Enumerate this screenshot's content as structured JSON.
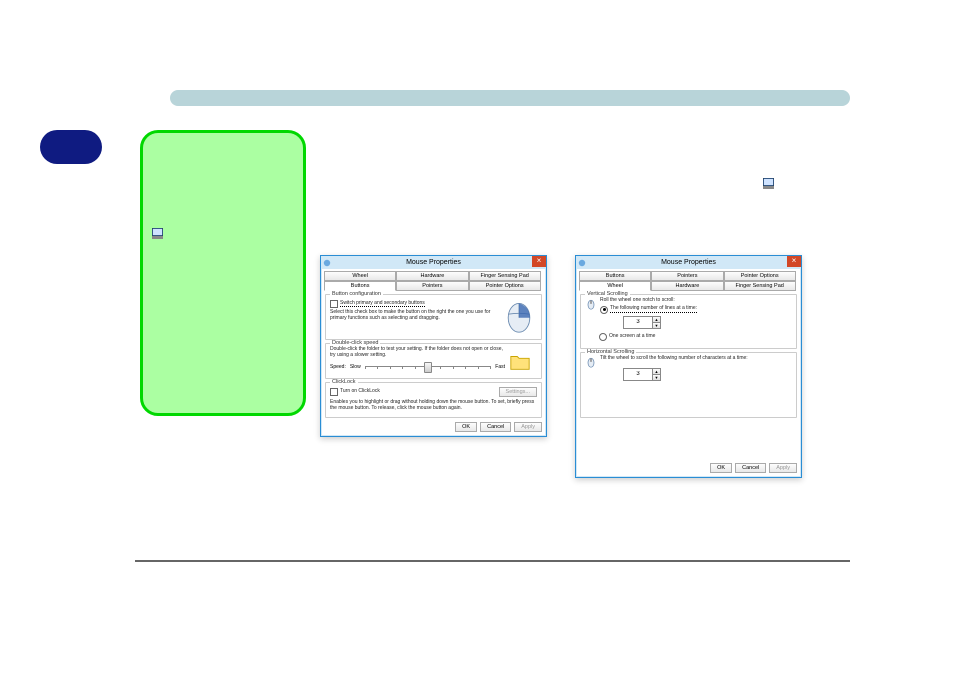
{
  "colors": {
    "accent": "#2a8dd4",
    "pill": "#0f1b81",
    "green": "#00d800"
  },
  "dialogs": [
    {
      "title": "Mouse Properties",
      "close": "×",
      "tabs_row1": [
        "Wheel",
        "Hardware",
        "Finger Sensing Pad"
      ],
      "tabs_row2": [
        "Buttons",
        "Pointers",
        "Pointer Options"
      ],
      "active_tab": "Buttons",
      "group1": {
        "title": "Button configuration",
        "cb_label": "Switch primary and secondary buttons",
        "desc": "Select this check box to make the button on the right the one you use for primary functions such as selecting and dragging."
      },
      "group2": {
        "title": "Double-click speed",
        "desc": "Double-click the folder to test your setting. If the folder does not open or close, try using a slower setting.",
        "speed_label": "Speed:",
        "slow": "Slow",
        "fast": "Fast"
      },
      "group3": {
        "title": "ClickLock",
        "cb_label": "Turn on ClickLock",
        "settings_btn": "Settings...",
        "desc": "Enables you to highlight or drag without holding down the mouse button. To set, briefly press the mouse button. To release, click the mouse button again."
      },
      "footer": {
        "ok": "OK",
        "cancel": "Cancel",
        "apply": "Apply"
      }
    },
    {
      "title": "Mouse Properties",
      "close": "×",
      "tabs_row1": [
        "Buttons",
        "Pointers",
        "Pointer Options"
      ],
      "tabs_row2": [
        "Wheel",
        "Hardware",
        "Finger Sensing Pad"
      ],
      "active_tab": "Wheel",
      "group1": {
        "title": "Vertical Scrolling",
        "line1": "Roll the wheel one notch to scroll:",
        "opt1": "The following number of lines at a time:",
        "opt1_value": "3",
        "opt2": "One screen at a time"
      },
      "group2": {
        "title": "Horizontal Scrolling",
        "line1": "Tilt the wheel to scroll the following number of characters at a time:",
        "value": "3"
      },
      "footer": {
        "ok": "OK",
        "cancel": "Cancel",
        "apply": "Apply"
      }
    }
  ]
}
